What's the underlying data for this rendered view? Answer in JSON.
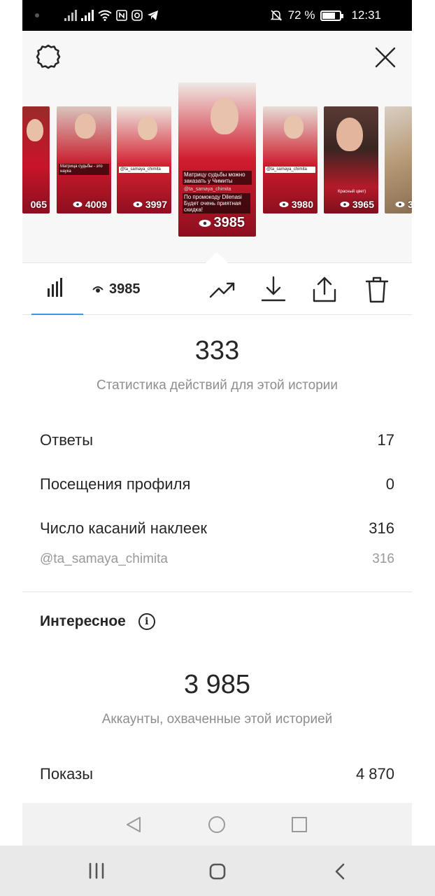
{
  "status_bar": {
    "battery_percent": "72 %",
    "battery_level": 0.72,
    "time": "12:31",
    "icons": [
      "signal-icon",
      "signal-icon",
      "wifi-icon",
      "nfc-icon",
      "instagram-icon",
      "telegram-icon",
      "mute-icon",
      "battery-icon"
    ]
  },
  "header": {
    "settings_icon": "gear-icon",
    "close_icon": "close-icon"
  },
  "stories": [
    {
      "views": "065",
      "caption": ""
    },
    {
      "views": "4009",
      "caption": "Матрица судьбы - это наука"
    },
    {
      "views": "3997",
      "caption": "@ta_samaya_chimita"
    },
    {
      "views": "3985",
      "caption": "Матрицу судьбы можно заказать у Чимиты",
      "caption2": "@ta_samaya_chimita",
      "caption3": "По промокоду Dilenasi Будет очень приятная скидка!"
    },
    {
      "views": "3980",
      "caption": "@ta_samaya_chimita"
    },
    {
      "views": "3965",
      "caption": "Красный цвет)"
    },
    {
      "views": "3",
      "caption": ""
    }
  ],
  "toolbar": {
    "views": "3985",
    "icons": [
      "stats-icon",
      "eye-icon",
      "trend-icon",
      "download-icon",
      "share-icon",
      "trash-icon"
    ]
  },
  "actions": {
    "total": "333",
    "caption": "Статистика действий для этой истории",
    "rows": [
      {
        "label": "Ответы",
        "value": "17"
      },
      {
        "label": "Посещения профиля",
        "value": "0"
      },
      {
        "label": "Число касаний наклеек",
        "value": "316"
      }
    ],
    "sticker": {
      "label": "@ta_samaya_chimita",
      "value": "316"
    }
  },
  "discovery": {
    "title": "Интересное",
    "info_icon": "info-icon",
    "total": "3 985",
    "caption": "Аккаунты, охваченные этой историей",
    "impressions_label": "Показы",
    "impressions_value": "4 870"
  },
  "nav": {
    "inner": [
      "back-triangle-icon",
      "home-circle-icon",
      "recents-square-icon"
    ],
    "system": [
      "recents-bars-icon",
      "home-icon",
      "back-chevron-icon"
    ]
  }
}
